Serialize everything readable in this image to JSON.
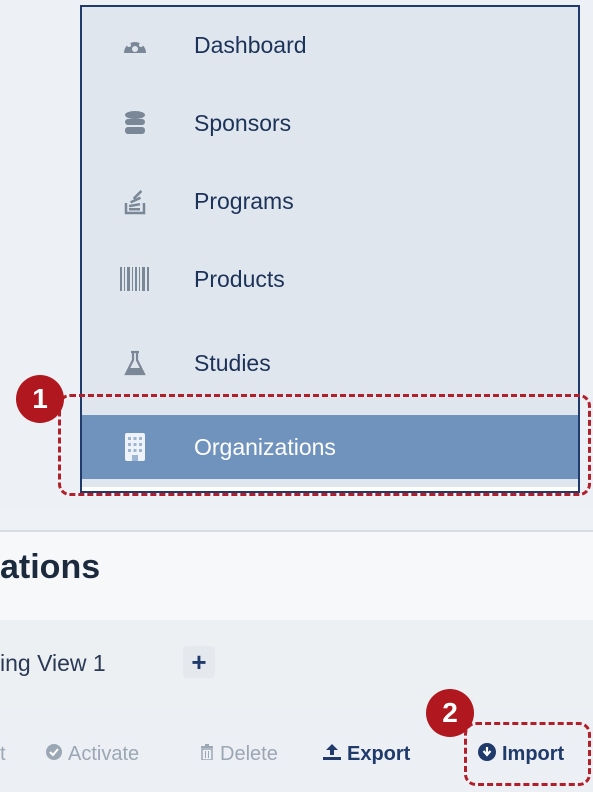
{
  "menu": {
    "items": [
      {
        "label": "Dashboard",
        "icon": "dashboard-gauge-icon",
        "active": false
      },
      {
        "label": "Sponsors",
        "icon": "database-icon",
        "active": false
      },
      {
        "label": "Programs",
        "icon": "stack-overflow-icon",
        "active": false
      },
      {
        "label": "Products",
        "icon": "barcode-icon",
        "active": false
      },
      {
        "label": "Studies",
        "icon": "flask-icon",
        "active": false
      },
      {
        "label": "Organizations",
        "icon": "building-icon",
        "active": true
      }
    ]
  },
  "callouts": {
    "step1": "1",
    "step2": "2",
    "color": "#b01f2a"
  },
  "page": {
    "title": "ations",
    "view_tab": "ing View 1",
    "add_view": "+"
  },
  "toolbar": {
    "partial_left": "t",
    "activate": "Activate",
    "delete": "Delete",
    "export": "Export",
    "import": "Import"
  },
  "colors": {
    "active_bg": "#6f93bd",
    "menu_bg": "#dfe6ee",
    "text_dark": "#1c3258",
    "accent_red": "#b0171f"
  }
}
